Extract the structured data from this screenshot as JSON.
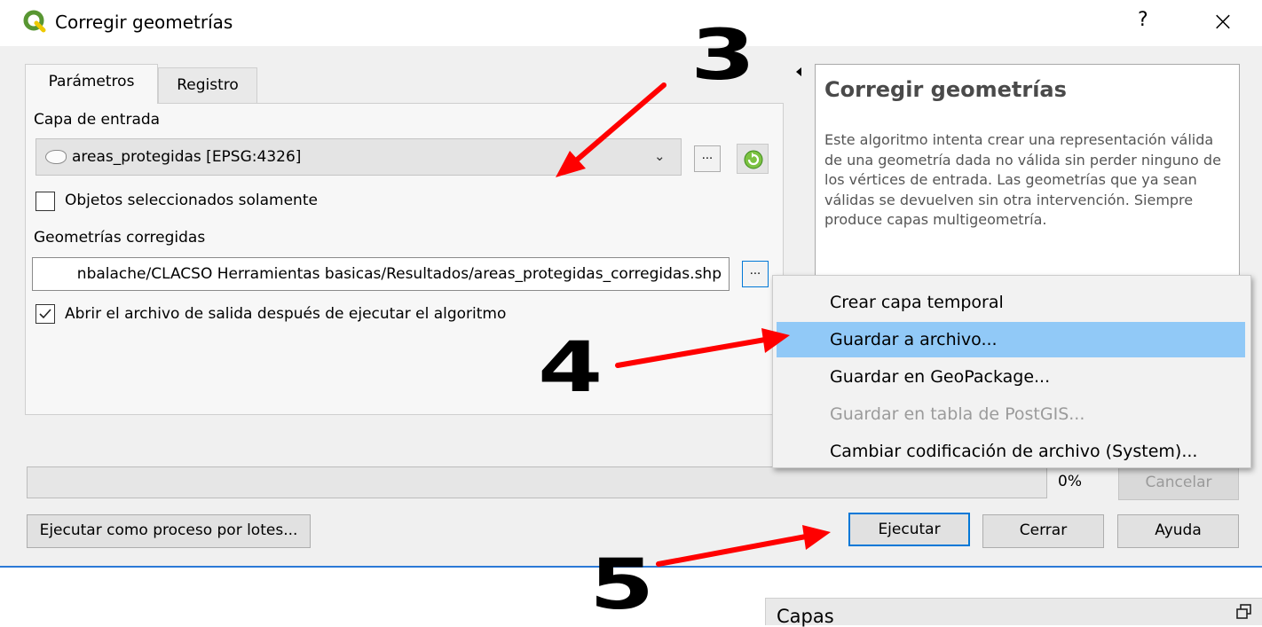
{
  "dialog": {
    "title": "Corregir geometrías",
    "help_button": "?",
    "close_button": "×",
    "brand_color": "#589632"
  },
  "tabs": [
    {
      "label": "Parámetros",
      "active": true
    },
    {
      "label": "Registro",
      "active": false
    }
  ],
  "params": {
    "input_label": "Capa de entrada",
    "input_value": "areas_protegidas [EPSG:4326]",
    "selected_only_label": "Objetos seleccionados solamente",
    "selected_only_checked": false,
    "output_label": "Geometrías corregidas",
    "output_value": "nbalache/CLACSO Herramientas basicas/Resultados/areas_protegidas_corregidas.shp",
    "open_output_label": "Abrir el archivo de salida después de ejecutar el algoritmo",
    "open_output_checked": true,
    "browse_label": "..."
  },
  "help": {
    "title": "Corregir geometrías",
    "body": "Este algoritmo intenta crear una representación válida de una geometría dada no válida sin perder ninguno de los vértices de entrada. Las geometrías que ya sean válidas se devuelven sin otra intervención. Siempre produce capas multigeometría."
  },
  "progress": {
    "percent_label": "0%",
    "value": 0
  },
  "buttons": {
    "cancel": "Cancelar",
    "batch": "Ejecutar como proceso por lotes...",
    "run": "Ejecutar",
    "close": "Cerrar",
    "help": "Ayuda"
  },
  "output_menu": {
    "items": [
      {
        "label": "Crear capa temporal",
        "highlighted": false,
        "disabled": false
      },
      {
        "label": "Guardar a archivo...",
        "highlighted": true,
        "disabled": false
      },
      {
        "label": "Guardar en GeoPackage...",
        "highlighted": false,
        "disabled": false
      },
      {
        "label": "Guardar en tabla de PostGIS...",
        "highlighted": false,
        "disabled": true
      },
      {
        "label": "Cambiar codificación de archivo (System)...",
        "highlighted": false,
        "disabled": false
      }
    ]
  },
  "annotations": {
    "step3": "3",
    "step4": "4",
    "step5": "5",
    "arrow_color": "#ff0000"
  },
  "layers_panel": {
    "title": "Capas"
  }
}
